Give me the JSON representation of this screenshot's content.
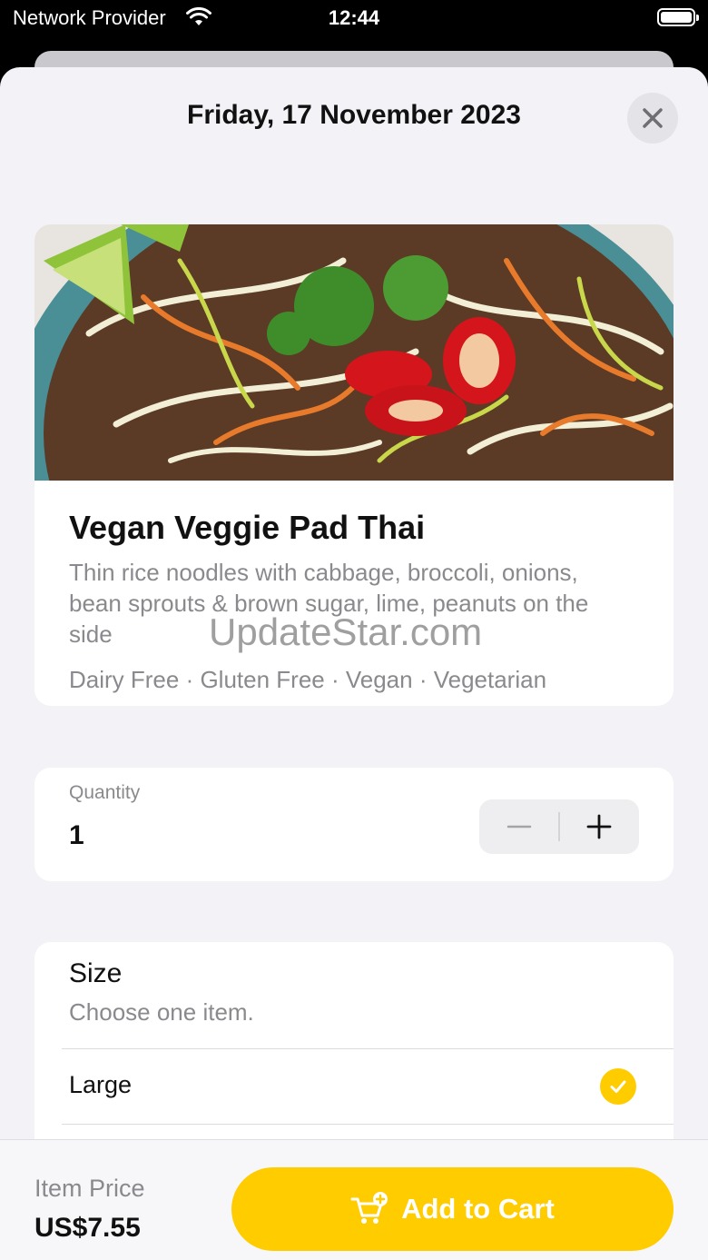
{
  "status_bar": {
    "carrier": "Network Provider",
    "time": "12:44"
  },
  "sheet": {
    "title": "Friday, 17 November 2023"
  },
  "food": {
    "name": "Vegan Veggie Pad Thai",
    "description": "Thin rice noodles with cabbage, broccoli, onions, bean sprouts & brown sugar, lime, peanuts on the side",
    "tags": "Dairy Free · Gluten Free · Vegan · Vegetarian",
    "image_icon": "noodle-dish-photo"
  },
  "watermark": "UpdateStar.com",
  "quantity": {
    "label": "Quantity",
    "value": "1"
  },
  "size": {
    "title": "Size",
    "subtitle": "Choose one item.",
    "options": [
      {
        "label": "Large",
        "selected": true
      }
    ]
  },
  "footer": {
    "price_label": "Item Price",
    "price_value": "US$7.55",
    "add_to_cart_label": "Add to Cart"
  },
  "colors": {
    "accent": "#ffcc00",
    "background": "#f2f2f7",
    "secondary_text": "#8a8a8e"
  }
}
